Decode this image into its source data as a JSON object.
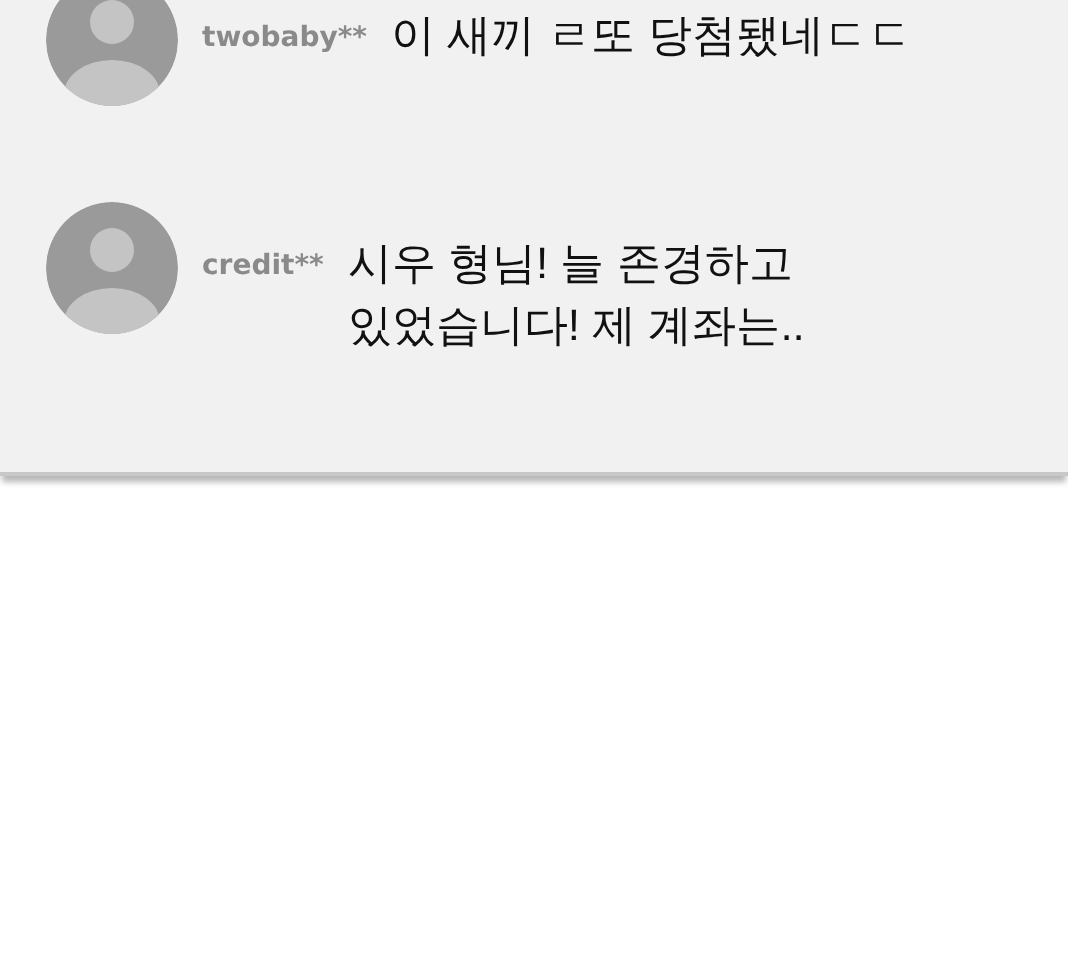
{
  "comments": [
    {
      "user": "twobaby**",
      "text": "이 새끼 ㄹ또 당첨됐네ㄷㄷ"
    },
    {
      "user": "credit**",
      "text": "시우 형님! 늘 존경하고\n있었습니다! 제 계좌는.."
    }
  ]
}
